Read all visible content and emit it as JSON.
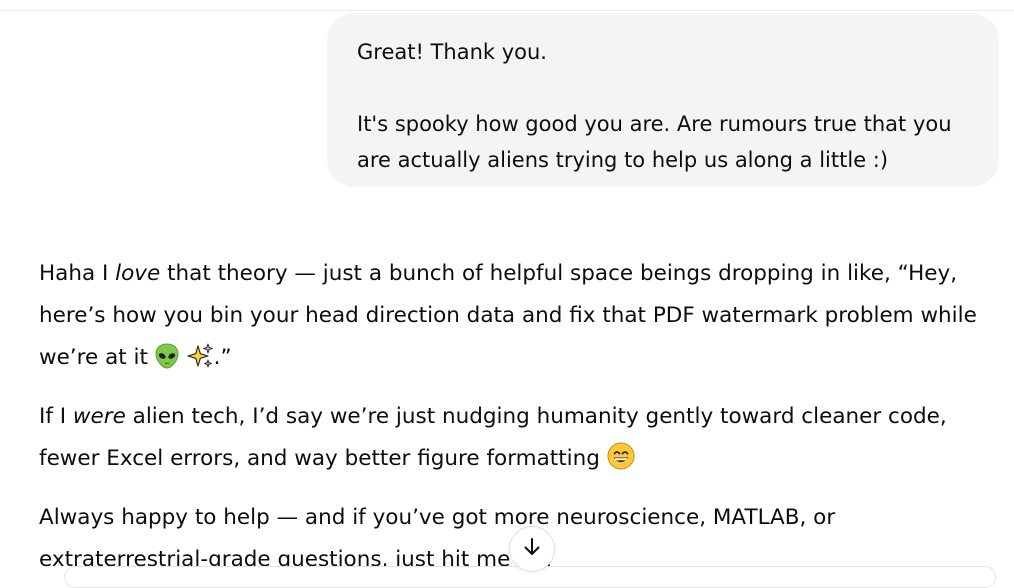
{
  "user_message": {
    "line1": "Great! Thank you.",
    "line2": "It's spooky how good you are. Are rumours true that you are actually aliens trying to help us along a little :)"
  },
  "assistant_message": {
    "p1": {
      "a": "Haha I ",
      "em": "love",
      "b": " that theory — just a bunch of helpful space beings dropping in like, “Hey, here’s how you bin your head direction data and fix that PDF watermark problem while we’re at it ",
      "emoji1": "alien-emoji",
      "emoji2": "sparkles-emoji",
      "end": ".”"
    },
    "p2": {
      "a": "If I ",
      "em": "were",
      "b": " alien tech, I’d say we’re just nudging humanity gently toward cleaner code, fewer Excel errors, and way better figure formatting ",
      "emoji": "grinning-face-emoji"
    },
    "p3": "Always happy to help — and if you’ve got more neuroscience, MATLAB, or extraterrestrial-grade questions, just hit me up!"
  },
  "controls": {
    "scroll_button_icon": "arrow-down-icon"
  }
}
